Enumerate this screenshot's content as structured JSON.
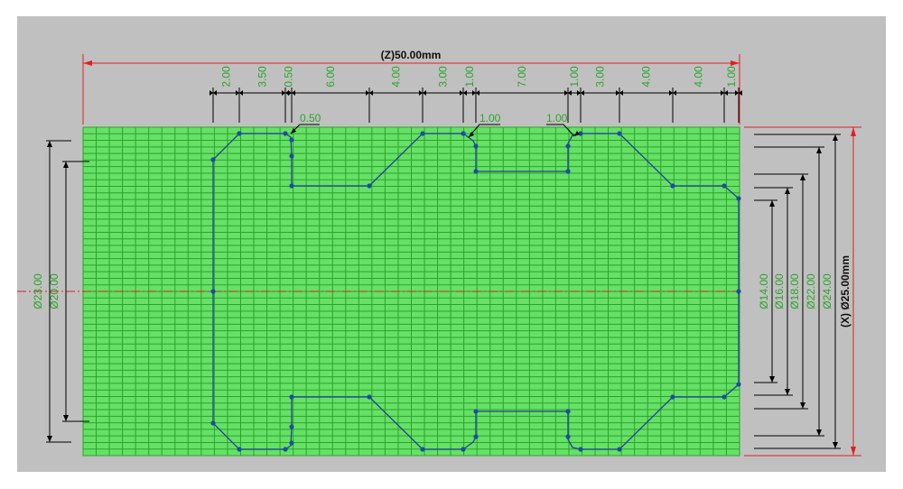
{
  "colors": {
    "background": "#c0c0c0",
    "grid_fill": "#66e066",
    "grid_line": "#2aa52a",
    "profile": "#22409a",
    "point": "#1a4f9a",
    "center_line": "#e02020",
    "overall_dimension": "#e02020",
    "dimension_line": "#000000",
    "dimension_text": "#2aa52a"
  },
  "overall": {
    "z_label": "(Z)50.00mm",
    "x_label": "(X) Ø25.00mm"
  },
  "top_dimensions": [
    "2.00",
    "3.50",
    "0.50",
    "6.00",
    "4.00",
    "3.00",
    "1.00",
    "7.00",
    "1.00",
    "3.00",
    "4.00",
    "4.00",
    "1.00"
  ],
  "chamfer_labels": [
    "0.50",
    "1.00",
    "1.00"
  ],
  "left_diameters": [
    "Ø23.00",
    "Ø20.00"
  ],
  "right_diameters": [
    "Ø14.00",
    "Ø16.00",
    "Ø18.00",
    "Ø22.00",
    "Ø24.00"
  ]
}
